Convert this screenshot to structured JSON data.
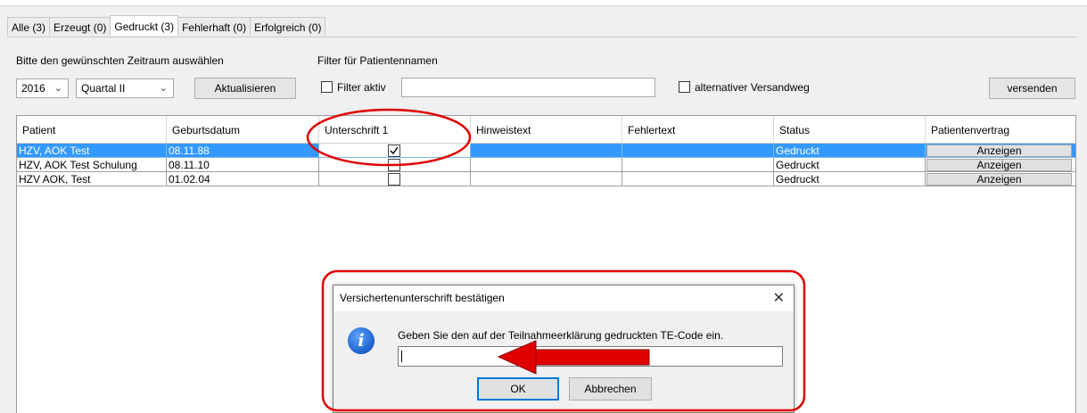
{
  "tabs": [
    {
      "label": "Alle (3)"
    },
    {
      "label": "Erzeugt (0)"
    },
    {
      "label": "Gedruckt (3)"
    },
    {
      "label": "Fehlerhaft (0)"
    },
    {
      "label": "Erfolgreich (0)"
    }
  ],
  "period": {
    "label": "Bitte den gewünschten Zeitraum auswählen",
    "year": "2016",
    "quarter": "Quartal II",
    "refresh_label": "Aktualisieren"
  },
  "filter": {
    "label": "Filter für Patientennamen",
    "active_label": "Filter aktiv",
    "value": ""
  },
  "alt_shipping_label": "alternativer Versandweg",
  "send_label": "versenden",
  "table": {
    "columns": [
      "Patient",
      "Geburtsdatum",
      "Unterschrift 1",
      "Hinweistext",
      "Fehlertext",
      "Status",
      "Patientenvertrag"
    ],
    "rows": [
      {
        "patient": "HZV, AOK Test",
        "dob": "08.11.88",
        "signed": true,
        "hint": "",
        "error": "",
        "status": "Gedruckt",
        "action": "Anzeigen"
      },
      {
        "patient": "HZV, AOK Test Schulung",
        "dob": "08.11.10",
        "signed": false,
        "hint": "",
        "error": "",
        "status": "Gedruckt",
        "action": "Anzeigen"
      },
      {
        "patient": "HZV AOK, Test",
        "dob": "01.02.04",
        "signed": false,
        "hint": "",
        "error": "",
        "status": "Gedruckt",
        "action": "Anzeigen"
      }
    ]
  },
  "dialog": {
    "title": "Versichertenunterschrift bestätigen",
    "message": "Geben Sie den auf der Teilnahmeerklärung gedruckten TE-Code ein.",
    "input_value": "",
    "ok_label": "OK",
    "cancel_label": "Abbrechen",
    "icon": "info-icon",
    "close_icon": "close-icon"
  },
  "colors": {
    "selection": "#3399ff",
    "annotation": "#e00000",
    "dialog_default_border": "#0078d7"
  }
}
